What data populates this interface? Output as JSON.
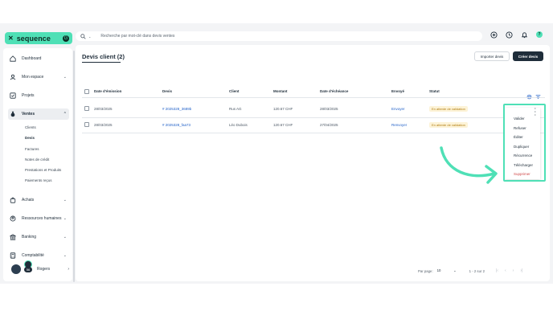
{
  "app": {
    "logo_text": "sequence",
    "logo_badge": "G"
  },
  "sidebar": {
    "items": [
      {
        "label": "Dashboard",
        "icon": "home-icon"
      },
      {
        "label": "Mon espace",
        "icon": "user-icon"
      },
      {
        "label": "Projets",
        "icon": "check-square-icon"
      },
      {
        "label": "Ventes",
        "icon": "money-bag-icon"
      },
      {
        "label": "Achats",
        "icon": "shopping-bag-icon"
      },
      {
        "label": "Ressources humaines",
        "icon": "people-icon"
      },
      {
        "label": "Banking",
        "icon": "bank-icon"
      },
      {
        "label": "Comptabilité",
        "icon": "calculator-icon"
      }
    ],
    "sub_items": [
      "Clients",
      "Devis",
      "Factures",
      "Notes de crédit",
      "Prestations et Produits",
      "Paiements reçus"
    ],
    "user_name": "Rogers",
    "notif_count": "56"
  },
  "search": {
    "placeholder": "Recherche par mot-clé dans devis ventes"
  },
  "page": {
    "title": "Devis client (2)",
    "import_label": "Importer devis",
    "create_label": "Créer devis"
  },
  "table": {
    "headers": [
      "Date d'émission",
      "Devis",
      "Client",
      "Montant",
      "Date d'échéance",
      "Envoyé",
      "Statut"
    ],
    "rows": [
      {
        "date": "28/03/2025",
        "devis": "# 2025328_3689b",
        "client": "Rus AG",
        "montant": "120.67 CHF",
        "echeance": "28/03/2025",
        "envoye": "Envoyer",
        "statut": "En attente de validation"
      },
      {
        "date": "28/03/2025",
        "devis": "# 2025328_faa73",
        "client": "Léo Dubois",
        "montant": "120.67 CHF",
        "echeance": "27/04/2025",
        "envoye": "Renvoyer",
        "statut": "En attente de validation"
      }
    ]
  },
  "footer": {
    "per_page_label": "Par page:",
    "per_page_value": "10",
    "range": "1 - 2 sur 2",
    "pager": [
      "|‹",
      "‹",
      "›",
      "›|"
    ]
  },
  "menu": {
    "items": [
      "Valider",
      "Refuser",
      "Éditer",
      "Dupliquer",
      "Récurrence",
      "Télécharger",
      "Supprimer"
    ]
  },
  "colors": {
    "accent": "#4fe0b6",
    "dark": "#1f2d3a",
    "link": "#2563c9",
    "status_bg": "#fdf3d7",
    "status_text": "#b07d12"
  }
}
